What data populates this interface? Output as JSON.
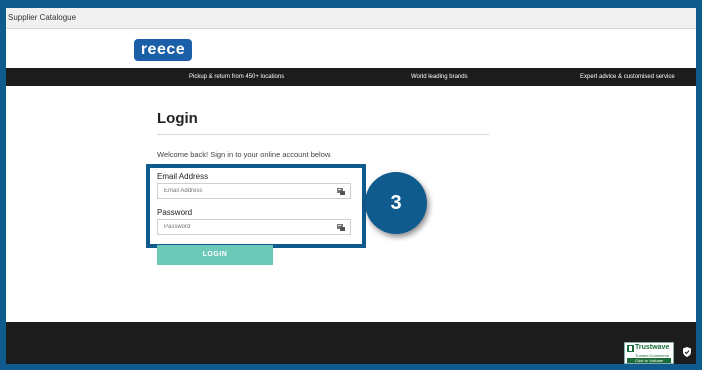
{
  "tab": {
    "title": "Supplier Catalogue"
  },
  "brand": {
    "logo_text": "reece"
  },
  "nav": {
    "items": [
      "Pickup & return from 450+ locations",
      "World leading brands",
      "Expert advice & customised service"
    ]
  },
  "login": {
    "title": "Login",
    "welcome": "Welcome back! Sign in to your online account below.",
    "email_label": "Email Address",
    "email_placeholder": "Email Address",
    "password_label": "Password",
    "password_placeholder": "Password",
    "button_label": "LOGIN"
  },
  "annotation": {
    "step_number": "3"
  },
  "footer": {
    "trust_name": "Trustwave",
    "trust_sub": "Trusted Commerce",
    "trust_verify": "Click to Validate"
  },
  "colors": {
    "frame_border": "#0f5b8e",
    "logo_bg": "#1a5fa8",
    "nav_bg": "#1c1c1c",
    "login_button": "#6cc9b8",
    "step_badge": "#0f5b8e"
  }
}
